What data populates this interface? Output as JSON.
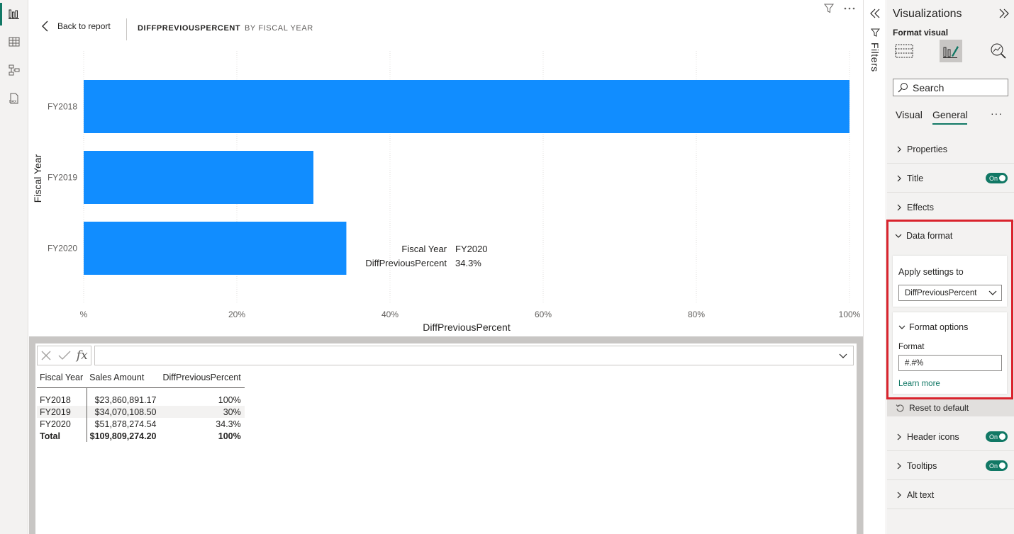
{
  "rail": {
    "items": [
      {
        "name": "report-view",
        "active": true
      },
      {
        "name": "table-view",
        "active": false
      },
      {
        "name": "model-view",
        "active": false
      },
      {
        "name": "dax-query-view",
        "active": false
      }
    ]
  },
  "canvas": {
    "back_label": "Back to report",
    "crumb_measure": "DIFFPREVIOUSPERCENT",
    "crumb_by": "BY FISCAL YEAR"
  },
  "chart_data": {
    "type": "bar",
    "orientation": "horizontal",
    "categories": [
      "FY2018",
      "FY2019",
      "FY2020"
    ],
    "values": [
      100,
      30,
      34.3
    ],
    "xlabel": "DiffPreviousPercent",
    "ylabel": "Fiscal Year",
    "xlim": [
      0,
      100
    ],
    "xticks": [
      "%",
      "20%",
      "40%",
      "60%",
      "80%",
      "100%"
    ],
    "bar_color": "#118DFF",
    "grid": "vertical-dotted",
    "tooltip": {
      "category_index": 2,
      "rows": [
        {
          "label": "Fiscal Year",
          "value": "FY2020"
        },
        {
          "label": "DiffPreviousPercent",
          "value": "34.3%"
        }
      ]
    }
  },
  "dax": {
    "formula": "",
    "fx_label": "fx",
    "table": {
      "headers": [
        "Fiscal Year",
        "Sales Amount",
        "DiffPreviousPercent"
      ],
      "rows": [
        [
          "FY2018",
          "$23,860,891.17",
          "100%"
        ],
        [
          "FY2019",
          "$34,070,108.50",
          "30%"
        ],
        [
          "FY2020",
          "$51,878,274.54",
          "34.3%"
        ]
      ],
      "total": [
        "Total",
        "$109,809,274.20",
        "100%"
      ]
    }
  },
  "filters": {
    "label": "Filters"
  },
  "viz": {
    "title": "Visualizations",
    "format_label": "Format visual",
    "search_placeholder": "Search",
    "tabs": [
      "Visual",
      "General"
    ],
    "active_tab": "General",
    "more": "···",
    "sections": {
      "properties": "Properties",
      "title": "Title",
      "effects": "Effects",
      "data_format": "Data format",
      "header_icons": "Header icons",
      "tooltips": "Tooltips",
      "alt_text": "Alt text"
    },
    "toggle_on": "On",
    "apply_settings_label": "Apply settings to",
    "apply_settings_value": "DiffPreviousPercent",
    "format_options_label": "Format options",
    "format_label_field": "Format",
    "format_value": "#.#%",
    "learn_more": "Learn more",
    "reset_label": "Reset to default"
  },
  "colors": {
    "accent": "#117865",
    "bar": "#118DFF",
    "highlight": "#D9232D"
  }
}
